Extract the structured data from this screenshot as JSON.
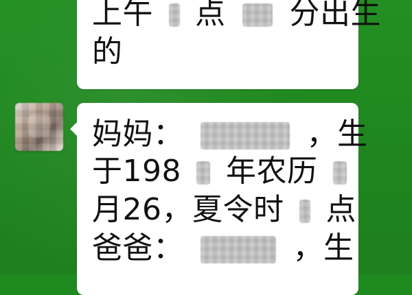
{
  "top_bubble": {
    "line1_part1": "上午",
    "line1_part2": "点",
    "line1_part3": "分出生",
    "line2": "的"
  },
  "bottom_bubble": {
    "line1_prefix": "妈妈：",
    "line1_suffix": "，生",
    "line2_prefix": "于198",
    "line2_suffix": "年农历",
    "line3_prefix": "月26，夏令时",
    "line3_suffix": "点",
    "line4_prefix": "爸爸：",
    "line4_suffix": "，生"
  }
}
